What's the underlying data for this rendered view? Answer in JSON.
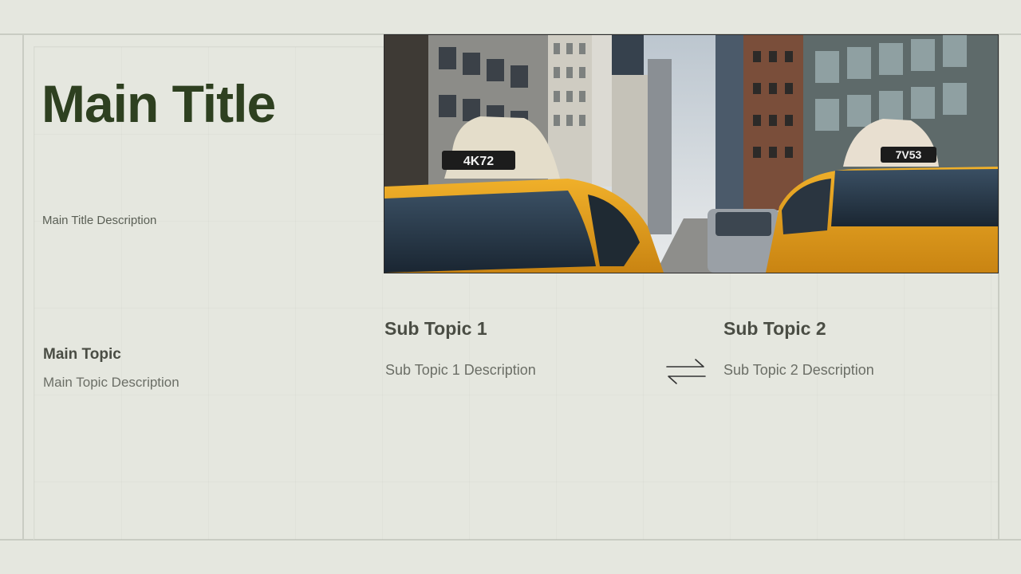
{
  "slide": {
    "title": "Main Title",
    "title_description": "Main Title Description"
  },
  "hero_image": {
    "taxi_left_sign": "4K72",
    "taxi_right_sign": "7V53"
  },
  "main_topic": {
    "title": "Main Topic",
    "description": "Main Topic Description"
  },
  "sub_topics": [
    {
      "title": "Sub Topic 1",
      "description": "Sub Topic 1 Description"
    },
    {
      "title": "Sub Topic 2",
      "description": "Sub Topic 2 Description"
    }
  ],
  "icons": {
    "exchange": "exchange-arrows-icon"
  },
  "colors": {
    "background": "#e5e7df",
    "title": "#2e4020",
    "taxi": "#e8a21a"
  }
}
